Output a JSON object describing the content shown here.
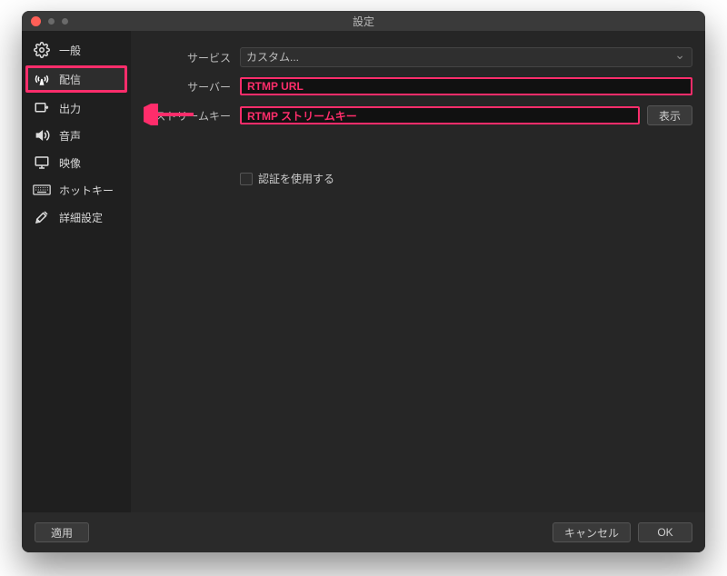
{
  "window": {
    "title": "設定"
  },
  "sidebar": {
    "items": [
      {
        "label": "一般"
      },
      {
        "label": "配信"
      },
      {
        "label": "出力"
      },
      {
        "label": "音声"
      },
      {
        "label": "映像"
      },
      {
        "label": "ホットキー"
      },
      {
        "label": "詳細設定"
      }
    ]
  },
  "form": {
    "service_label": "サービス",
    "service_value": "カスタム...",
    "server_label": "サーバー",
    "server_value": "RTMP URL",
    "streamkey_label": "ストリームキー",
    "streamkey_value": "RTMP ストリームキー",
    "show_button": "表示",
    "auth_checkbox_label": "認証を使用する"
  },
  "footer": {
    "apply": "適用",
    "cancel": "キャンセル",
    "ok": "OK"
  }
}
